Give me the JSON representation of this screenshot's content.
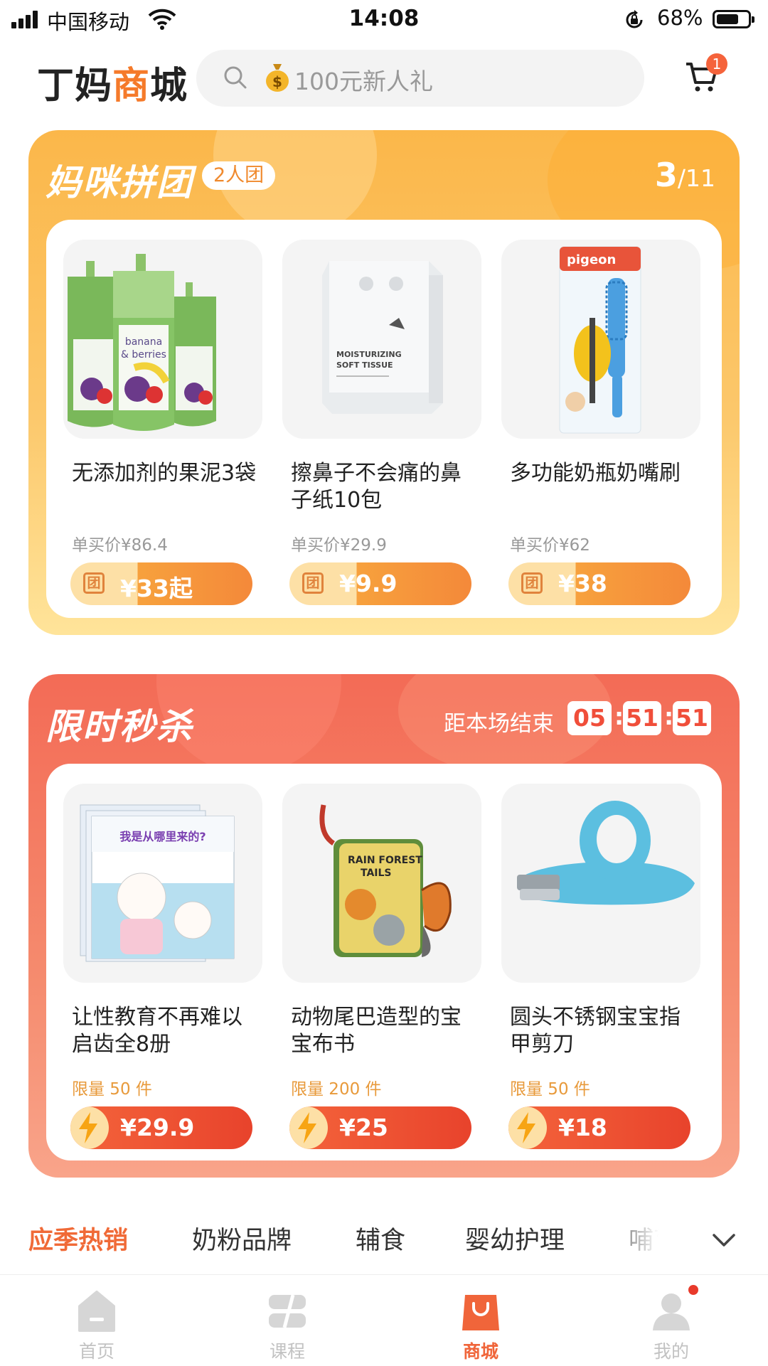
{
  "status_bar": {
    "carrier": "中国移动",
    "time": "14:08",
    "battery": "68%",
    "battery_level": 0.68
  },
  "header": {
    "logo_prefix": "丁妈",
    "logo_highlight": "商",
    "logo_suffix": "城",
    "search_placeholder": "100元新人礼",
    "cart_badge": "1"
  },
  "group_buy": {
    "title": "妈咪拼团",
    "tag": "2人团",
    "page_current": "3",
    "page_total": "/11",
    "group_mark": "团",
    "items": [
      {
        "title": "无添加剂的果泥3袋",
        "orig_price": "单买价¥86.4",
        "price": "¥33起"
      },
      {
        "title": "擦鼻子不会痛的鼻子纸10包",
        "orig_price": "单买价¥29.9",
        "price": "¥9.9"
      },
      {
        "title": "多功能奶瓶奶嘴刷",
        "orig_price": "单买价¥62",
        "price": "¥38"
      }
    ]
  },
  "flash_sale": {
    "title": "限时秒杀",
    "countdown_label": "距本场结束",
    "countdown": {
      "h": "05",
      "m": "51",
      "s": "51",
      "sep": ":"
    },
    "items": [
      {
        "title": "让性教育不再难以启齿全8册",
        "limit": "限量 50 件",
        "price": "¥29.9"
      },
      {
        "title": "动物尾巴造型的宝宝布书",
        "limit": "限量 200 件",
        "price": "¥25"
      },
      {
        "title": "圆头不锈钢宝宝指甲剪刀",
        "limit": "限量 50 件",
        "price": "¥18"
      }
    ]
  },
  "category_tabs": [
    {
      "label": "应季热销",
      "active": true
    },
    {
      "label": "奶粉品牌"
    },
    {
      "label": "辅食"
    },
    {
      "label": "婴幼护理"
    },
    {
      "label": "哺育"
    }
  ],
  "bottom_nav": [
    {
      "label": "首页",
      "icon": "home-icon"
    },
    {
      "label": "课程",
      "icon": "course-icon"
    },
    {
      "label": "商城",
      "icon": "shop-bag-icon",
      "active": true
    },
    {
      "label": "我的",
      "icon": "profile-icon"
    }
  ],
  "colors": {
    "accent": "#f06a37",
    "group_card": "#fbb74a",
    "flash_card": "#f36b56"
  }
}
